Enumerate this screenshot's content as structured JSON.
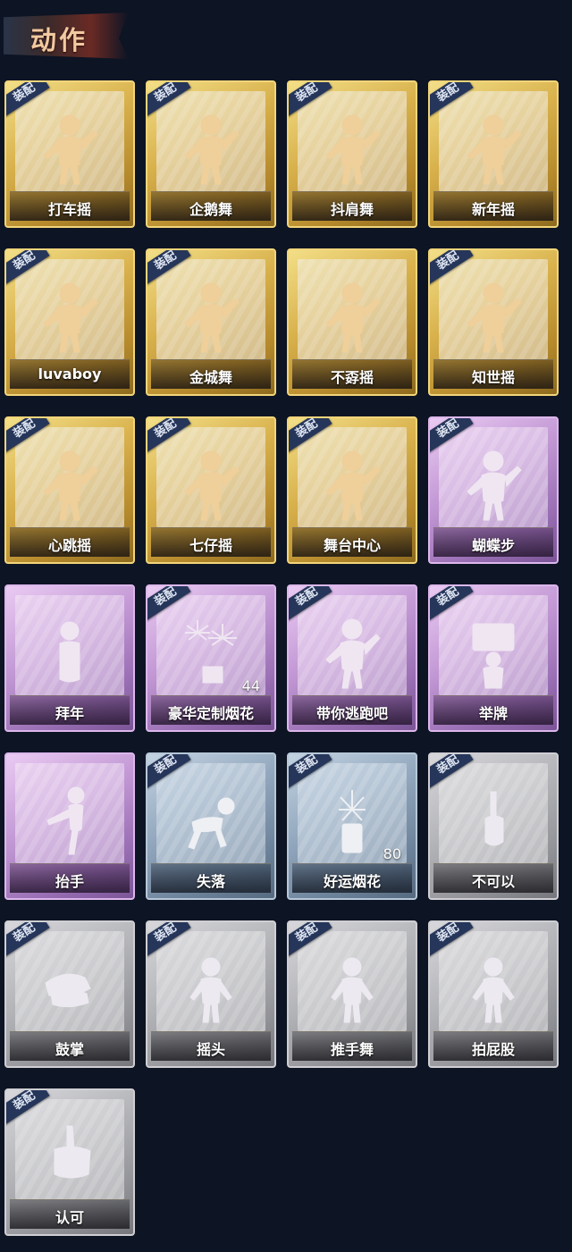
{
  "header": {
    "title": "动作"
  },
  "equip_label": "装配",
  "cards": [
    {
      "label": "打车摇",
      "rarity": "gold",
      "equipped": true,
      "icon": "dancer-icon"
    },
    {
      "label": "企鹅舞",
      "rarity": "gold",
      "equipped": true,
      "icon": "dancer-icon"
    },
    {
      "label": "抖肩舞",
      "rarity": "gold",
      "equipped": true,
      "icon": "dancer-icon"
    },
    {
      "label": "新年摇",
      "rarity": "gold",
      "equipped": true,
      "icon": "dancer-icon"
    },
    {
      "label": "luvaboy",
      "rarity": "gold",
      "equipped": true,
      "icon": "dancer-icon"
    },
    {
      "label": "金城舞",
      "rarity": "gold",
      "equipped": true,
      "icon": "dancer-icon"
    },
    {
      "label": "不孬摇",
      "rarity": "gold",
      "equipped": false,
      "icon": "dancer-icon"
    },
    {
      "label": "知世摇",
      "rarity": "gold",
      "equipped": true,
      "icon": "dancer-icon"
    },
    {
      "label": "心跳摇",
      "rarity": "gold",
      "equipped": true,
      "icon": "dancer-icon"
    },
    {
      "label": "七仔摇",
      "rarity": "gold",
      "equipped": true,
      "icon": "dancer-icon"
    },
    {
      "label": "舞台中心",
      "rarity": "gold",
      "equipped": true,
      "icon": "dancer-icon"
    },
    {
      "label": "蝴蝶步",
      "rarity": "purple",
      "equipped": true,
      "icon": "dancer-icon"
    },
    {
      "label": "拜年",
      "rarity": "purple",
      "equipped": false,
      "icon": "bowing-figure-icon"
    },
    {
      "label": "豪华定制烟花",
      "rarity": "purple",
      "equipped": true,
      "icon": "fireworks-icon",
      "count": "44"
    },
    {
      "label": "带你逃跑吧",
      "rarity": "purple",
      "equipped": true,
      "icon": "dancer-icon"
    },
    {
      "label": "举牌",
      "rarity": "purple",
      "equipped": true,
      "icon": "sign-holder-icon"
    },
    {
      "label": "抬手",
      "rarity": "purple",
      "equipped": false,
      "icon": "wave-figure-icon"
    },
    {
      "label": "失落",
      "rarity": "blue",
      "equipped": true,
      "icon": "crawling-figure-icon"
    },
    {
      "label": "好运烟花",
      "rarity": "blue",
      "equipped": true,
      "icon": "firework-can-icon",
      "count": "80"
    },
    {
      "label": "不可以",
      "rarity": "gray",
      "equipped": true,
      "icon": "finger-wag-icon"
    },
    {
      "label": "鼓掌",
      "rarity": "gray",
      "equipped": true,
      "icon": "clapping-hands-icon"
    },
    {
      "label": "摇头",
      "rarity": "gray",
      "equipped": true,
      "icon": "figure-icon"
    },
    {
      "label": "推手舞",
      "rarity": "gray",
      "equipped": true,
      "icon": "figure-icon"
    },
    {
      "label": "拍屁股",
      "rarity": "gray",
      "equipped": true,
      "icon": "figure-icon"
    },
    {
      "label": "认可",
      "rarity": "gray",
      "equipped": true,
      "icon": "thumbs-up-icon"
    }
  ]
}
